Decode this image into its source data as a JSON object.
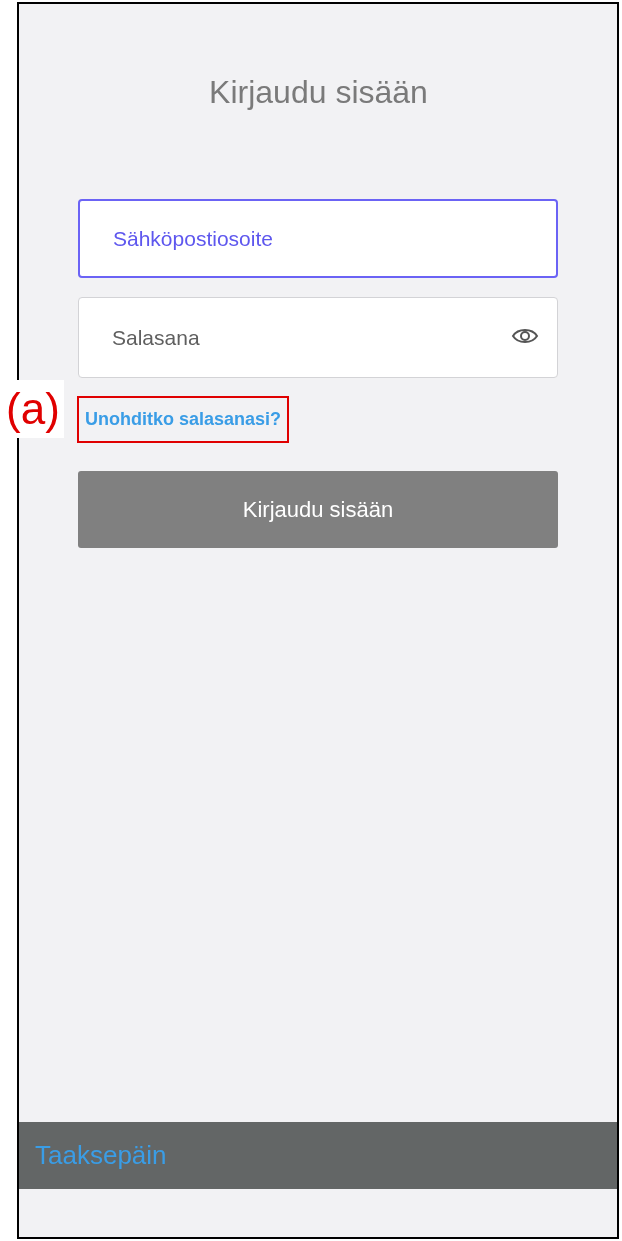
{
  "title": "Kirjaudu sisään",
  "email_field": {
    "placeholder": "Sähköpostiosoite",
    "focused": true
  },
  "password_field": {
    "placeholder": "Salasana",
    "focused": false
  },
  "forgot_link": "Unohditko salasanasi?",
  "login_button": {
    "label": "Kirjaudu sisään",
    "disabled": true
  },
  "bottom_bar": {
    "back_link": "Taaksepäin"
  },
  "annotation": {
    "label": "(a)"
  }
}
